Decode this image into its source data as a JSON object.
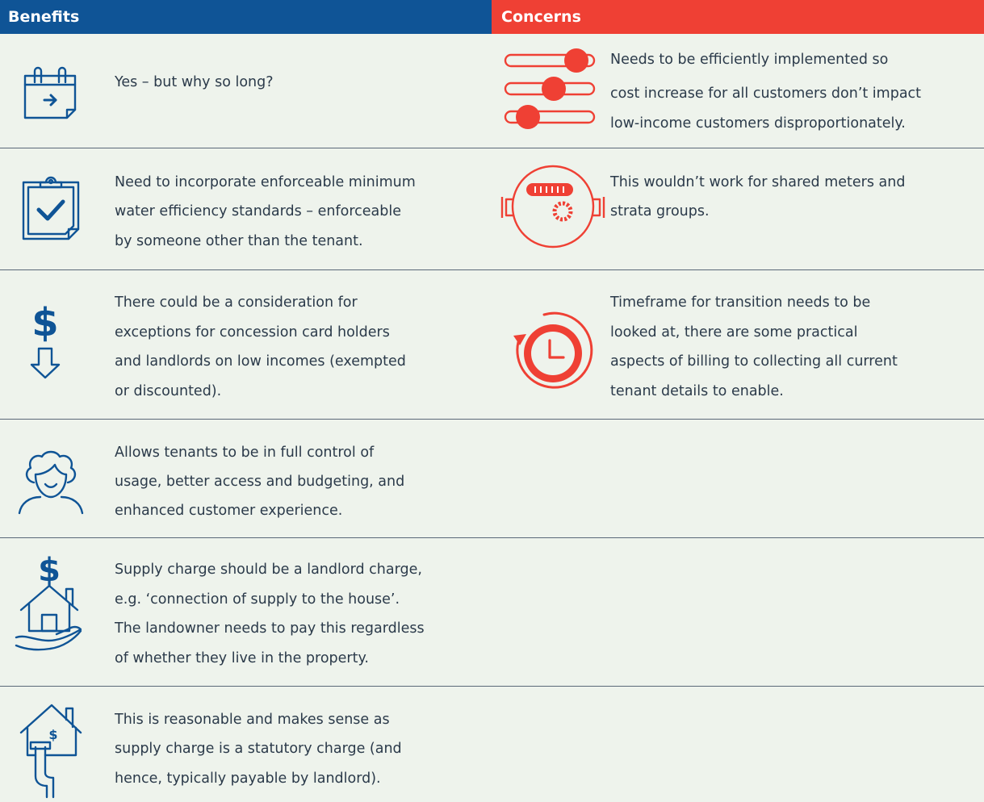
{
  "header": {
    "benefits_label": "Benefits",
    "concerns_label": "Concerns"
  },
  "colors": {
    "benefit_blue": "#0f5496",
    "concern_red": "#ef4034",
    "background": "#eef3ec"
  },
  "rows": [
    {
      "benefit_icon": "calendar-arrow-icon",
      "benefit_lines": [
        "Yes – but why so long?"
      ],
      "concern_icon": "sliders-icon",
      "concern_lines": [
        "Needs to be efficiently implemented so",
        "cost increase for all customers don’t impact",
        "low-income customers disproportionately."
      ]
    },
    {
      "benefit_icon": "clipboard-check-icon",
      "benefit_lines": [
        "Need to incorporate enforceable minimum",
        "water efficiency standards – enforceable",
        "by someone other than the tenant."
      ],
      "concern_icon": "water-meter-icon",
      "concern_lines": [
        "This wouldn’t work for shared meters and",
        "strata groups."
      ]
    },
    {
      "benefit_icon": "dollar-down-icon",
      "benefit_lines": [
        "There could be a consideration for",
        "exceptions for concession card holders",
        "and landlords on low incomes (exempted",
        "or discounted)."
      ],
      "concern_icon": "clock-cycle-icon",
      "concern_lines": [
        "Timeframe for transition needs to be",
        "looked at, there are some practical",
        "aspects of billing to collecting all current",
        "tenant details to enable."
      ]
    },
    {
      "benefit_icon": "person-icon",
      "benefit_lines": [
        "Allows tenants to be in full control of",
        "usage, better access and budgeting, and",
        "enhanced customer experience."
      ]
    },
    {
      "benefit_icon": "house-hand-dollar-icon",
      "benefit_lines": [
        "Supply charge should be a landlord charge,",
        "e.g. ‘connection of supply to the house’.",
        "The landowner needs to pay this regardless",
        "of whether they live in the property."
      ]
    },
    {
      "benefit_icon": "house-pipe-icon",
      "benefit_lines": [
        "This is reasonable and makes sense as",
        "supply charge is a statutory charge (and",
        "hence, typically payable by landlord)."
      ]
    }
  ]
}
